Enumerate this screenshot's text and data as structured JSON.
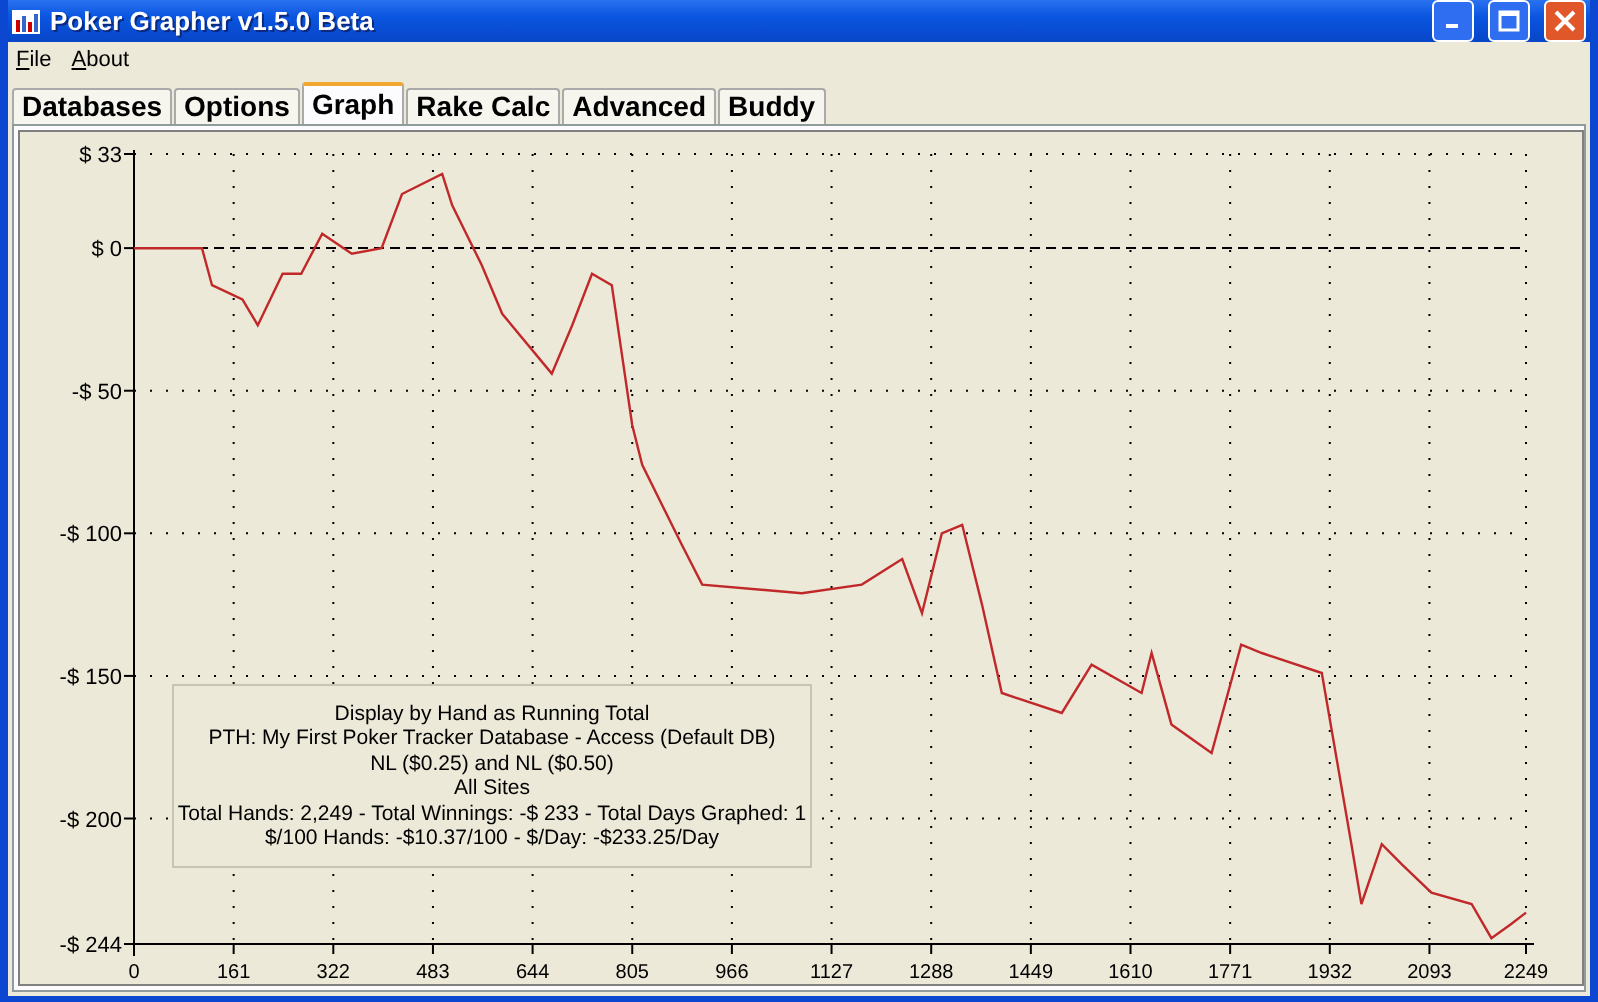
{
  "window": {
    "title": "Poker Grapher v1.5.0 Beta"
  },
  "menu": [
    {
      "label": "File"
    },
    {
      "label": "About"
    }
  ],
  "tabs": [
    {
      "label": "Databases",
      "selected": false
    },
    {
      "label": "Options",
      "selected": false
    },
    {
      "label": "Graph",
      "selected": true
    },
    {
      "label": "Rake Calc",
      "selected": false
    },
    {
      "label": "Advanced",
      "selected": false
    },
    {
      "label": "Buddy",
      "selected": false
    }
  ],
  "graph": {
    "legend": [
      "Display by Hand as Running Total",
      "PTH: My First Poker Tracker Database - Access (Default DB)",
      "NL ($0.25) and NL ($0.50)",
      "All Sites",
      "Total Hands: 2,249 - Total Winnings: -$ 233 - Total Days Graphed: 1",
      "$/100 Hands: -$10.37/100 - $/Day: -$233.25/Day"
    ],
    "chart_data": {
      "type": "line",
      "x": [
        0,
        110,
        126,
        175,
        200,
        240,
        270,
        304,
        352,
        400,
        433,
        498,
        514,
        562,
        595,
        675,
        708,
        740,
        772,
        805,
        821,
        885,
        918,
        1079,
        1176,
        1241,
        1273,
        1305,
        1338,
        1370,
        1402,
        1499,
        1547,
        1628,
        1644,
        1676,
        1741,
        1789,
        1822,
        1919,
        1967,
        1983,
        2016,
        2048,
        2096,
        2161,
        2193,
        2225,
        2249
      ],
      "grid": true,
      "series": [
        {
          "color": "#c0282a",
          "values": [
            0,
            0,
            -13,
            -18,
            -27,
            -9,
            -9,
            5,
            -2,
            0,
            19,
            26,
            15,
            -6,
            -23,
            -44,
            -27,
            -9,
            -13,
            -62,
            -76,
            -104,
            -118,
            -121,
            -118,
            -109,
            -128,
            -100,
            -97,
            -125,
            -156,
            -163,
            -146,
            -156,
            -142,
            -167,
            -177,
            -139,
            -142,
            -149,
            -209,
            -230,
            -209,
            -216,
            -226,
            -230,
            -242,
            -237,
            -233
          ]
        }
      ],
      "xlim": [
        0,
        2249
      ],
      "ylim": [
        -244,
        33
      ],
      "xticks": [
        0,
        161,
        322,
        483,
        644,
        805,
        966,
        1127,
        1288,
        1449,
        1610,
        1771,
        1932,
        2093,
        2249
      ],
      "yticks": [
        {
          "value": 33,
          "label": "$ 33"
        },
        {
          "value": 0,
          "label": "$ 0"
        },
        {
          "value": -50,
          "label": "-$ 50"
        },
        {
          "value": -100,
          "label": "-$ 100"
        },
        {
          "value": -150,
          "label": "-$ 150"
        },
        {
          "value": -200,
          "label": "-$ 200"
        },
        {
          "value": -244,
          "label": "-$ 244"
        }
      ]
    }
  }
}
